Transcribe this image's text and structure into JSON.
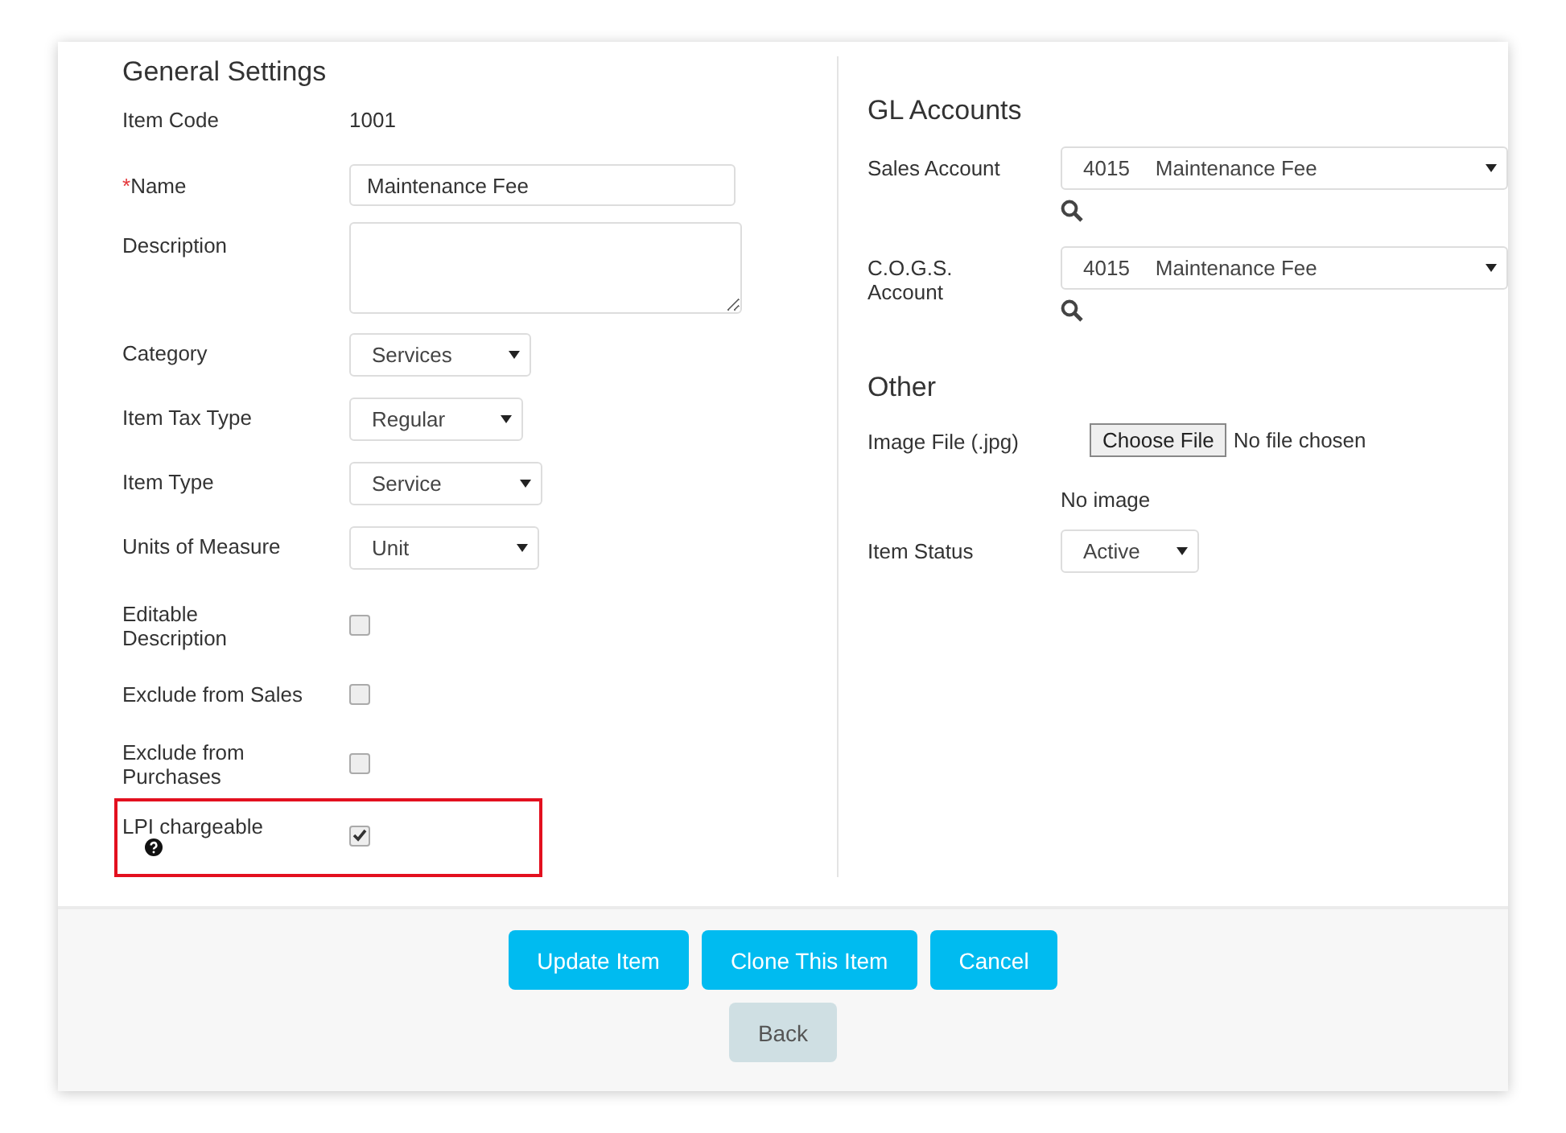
{
  "general_settings": {
    "title": "General Settings",
    "fields": [
      {
        "kind": "static",
        "label": "Item Code",
        "value": "1001"
      },
      {
        "kind": "input",
        "label": "Name",
        "required_mark": "*",
        "value": "Maintenance Fee"
      },
      {
        "kind": "textarea",
        "label": "Description"
      },
      {
        "kind": "select",
        "label": "Category",
        "value": "Services"
      },
      {
        "kind": "select",
        "label": "Item Tax Type",
        "value": "Regular"
      },
      {
        "kind": "select",
        "label": "Item Type",
        "value": "Service"
      },
      {
        "kind": "select",
        "label": "Units of Measure",
        "value": "Unit"
      },
      {
        "kind": "checkbox",
        "label": "Editable Description",
        "checked": false
      },
      {
        "kind": "checkbox",
        "label": "Exclude from Sales",
        "checked": false
      },
      {
        "kind": "checkbox",
        "label": "Exclude from Purchases",
        "checked": false
      },
      {
        "kind": "checkbox",
        "label": "LPI chargeable",
        "checked": true,
        "help": true,
        "highlighted": true
      }
    ]
  },
  "gl_accounts": {
    "title": "GL Accounts",
    "fields": [
      {
        "label": "Sales Account",
        "code": "4015",
        "name": "Maintenance Fee"
      },
      {
        "label": "C.O.G.S. Account",
        "code": "4015",
        "name": "Maintenance Fee"
      }
    ]
  },
  "other": {
    "title": "Other",
    "fields": [
      {
        "kind": "file",
        "label": "Image File (.jpg)",
        "button": "Choose File",
        "status": "No file chosen"
      },
      {
        "kind": "note",
        "value": "No image"
      },
      {
        "kind": "select",
        "label": "Item Status",
        "value": "Active"
      }
    ]
  },
  "actions": [
    {
      "label": "Update Item",
      "kind": "primary"
    },
    {
      "label": "Clone This Item",
      "kind": "primary"
    },
    {
      "label": "Cancel",
      "kind": "primary"
    },
    {
      "label": "Back",
      "kind": "secondary"
    }
  ]
}
